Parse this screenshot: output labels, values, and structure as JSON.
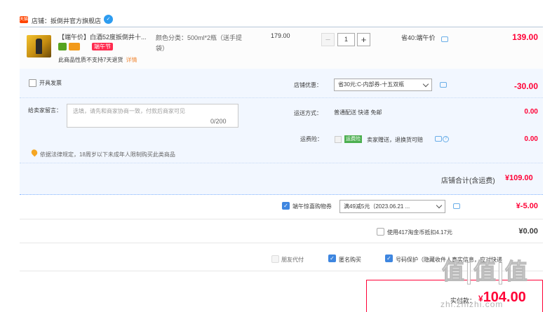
{
  "store": {
    "badge": "天猫",
    "label": "店铺：扳倒井官方旗舰店"
  },
  "item": {
    "title": "【端午价】白酒52度扳倒井十...",
    "festival_badge": "端午节",
    "return_note": "此商品性质不支持7天退货",
    "return_link": "详情",
    "spec": "颜色分类：500ml*2瓶（送手提袋）",
    "unit_price": "179.00",
    "qty_minus": "−",
    "qty_value": "1",
    "qty_plus": "+",
    "save_note": "省40:端午价",
    "line_total": "139.00"
  },
  "options": {
    "invoice_label": "开具发票",
    "message_label": "给卖家留言：",
    "message_placeholder": "选填，请先和商家协商一致，付款后商家可见",
    "message_count": "0/200",
    "law_note": "依据法律规定，18周岁以下未成年人限制购买此类商品",
    "store_discount_label": "店铺优惠：",
    "store_discount_value": "省30元:C-内部券-十五双瓶",
    "store_discount_amount": "-30.00",
    "shipping_label": "运送方式：",
    "shipping_value": "普通配送 快递 免邮",
    "shipping_amount": "0.00",
    "insurance_label": "运费险：",
    "insurance_badge": "运费险",
    "insurance_text": "卖家赠送，退换货可赔",
    "insurance_amount": "0.00",
    "store_total_label": "店铺合计(含运费)",
    "store_total": "¥109.00"
  },
  "promo": {
    "label": "端午惊喜购物券",
    "select_value": "满49减5元（2023.06.21 ...",
    "amount": "¥-5.00"
  },
  "coins": {
    "label": "使用417淘金币抵扣4.17元",
    "amount": "¥0.00"
  },
  "flags": {
    "friend_pay": "朋友代付",
    "anonymous": "匿名购买",
    "number_protect": "号码保护（隐藏收件人真实信息，应对快递"
  },
  "pay": {
    "label": "实付款：",
    "currency": "¥",
    "amount": "104.00"
  },
  "watermark": {
    "main": "值|值|值",
    "sub": "zhi.zhizhi.com"
  },
  "colors": {
    "accent_red": "#ff0036",
    "link_blue": "#3e86e0",
    "panel_blue": "#f2f7ff"
  }
}
